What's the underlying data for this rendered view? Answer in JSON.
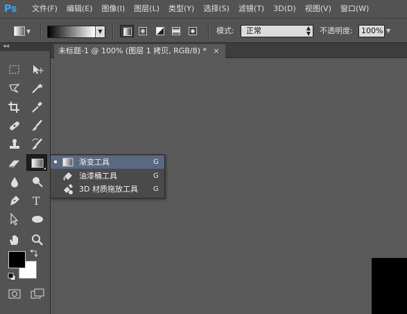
{
  "app": {
    "logo": "Ps"
  },
  "menu": [
    "文件(F)",
    "编辑(E)",
    "图像(I)",
    "图层(L)",
    "类型(Y)",
    "选择(S)",
    "滤镜(T)",
    "3D(D)",
    "视图(V)",
    "窗口(W)"
  ],
  "options": {
    "mode_label": "模式:",
    "mode_value": "正常",
    "opacity_label": "不透明度:",
    "opacity_value": "100%"
  },
  "toolbox": {
    "collapse_glyph": "◂◂"
  },
  "document": {
    "tab_title": "未标题-1 @ 100% (图层 1 拷贝, RGB/8) *",
    "close_glyph": "×"
  },
  "flyout": {
    "items": [
      {
        "label": "渐变工具",
        "shortcut": "G",
        "selected": true,
        "icon": "gradient-icon"
      },
      {
        "label": "油漆桶工具",
        "shortcut": "G",
        "selected": false,
        "icon": "paint-bucket-icon"
      },
      {
        "label": "3D 材质拖放工具",
        "shortcut": "G",
        "selected": false,
        "icon": "3d-material-drop-icon"
      }
    ]
  },
  "colors": {
    "foreground": "#000000",
    "background": "#ffffff",
    "flyout_highlight": "#5a6982",
    "ps_blue": "#31a8ff"
  }
}
